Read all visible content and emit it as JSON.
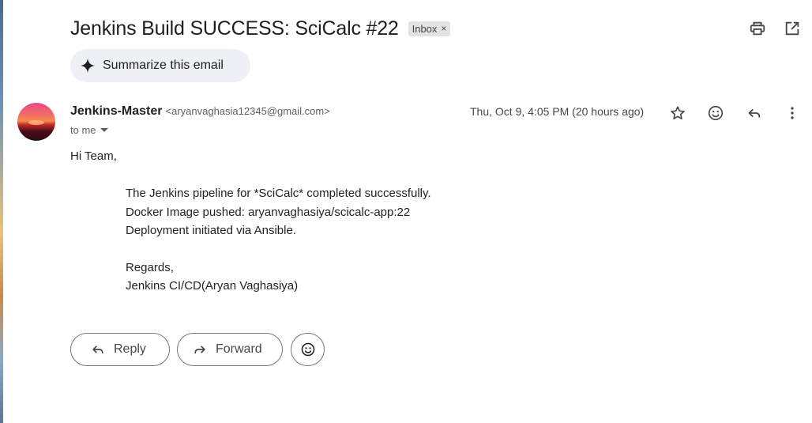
{
  "email": {
    "subject": "Jenkins Build SUCCESS: SciCalc #22",
    "label": "Inbox",
    "label_remove": "×",
    "summarize_label": "Summarize this email",
    "sender_name": "Jenkins-Master",
    "sender_email": "<aryanvaghasia12345@gmail.com>",
    "recipient": "to me",
    "date": "Thu, Oct 9, 4:05 PM (20 hours ago)",
    "body": {
      "greeting": "Hi Team,",
      "line1": "The Jenkins pipeline for *SciCalc* completed successfully.",
      "line2": "Docker Image pushed: aryanvaghasiya/scicalc-app:22",
      "line3": "Deployment initiated via Ansible.",
      "closing": "Regards,",
      "signature": "Jenkins CI/CD(Aryan Vaghasiya)"
    }
  },
  "actions": {
    "reply_label": "Reply",
    "forward_label": "Forward"
  },
  "icons": {
    "print": "print-icon",
    "open_new_window": "open-in-new-window-icon",
    "sparkle": "sparkle-icon",
    "star": "star-icon",
    "emoji": "emoji-icon",
    "reply": "reply-icon",
    "more": "more-vert-icon",
    "forward": "forward-icon"
  },
  "colors": {
    "text": "#1f1f1f",
    "secondary_text": "#5e5e5e",
    "summarize_bg": "#eef0f6",
    "chip_bg": "#e3e3e3",
    "pill_border": "#747775"
  }
}
